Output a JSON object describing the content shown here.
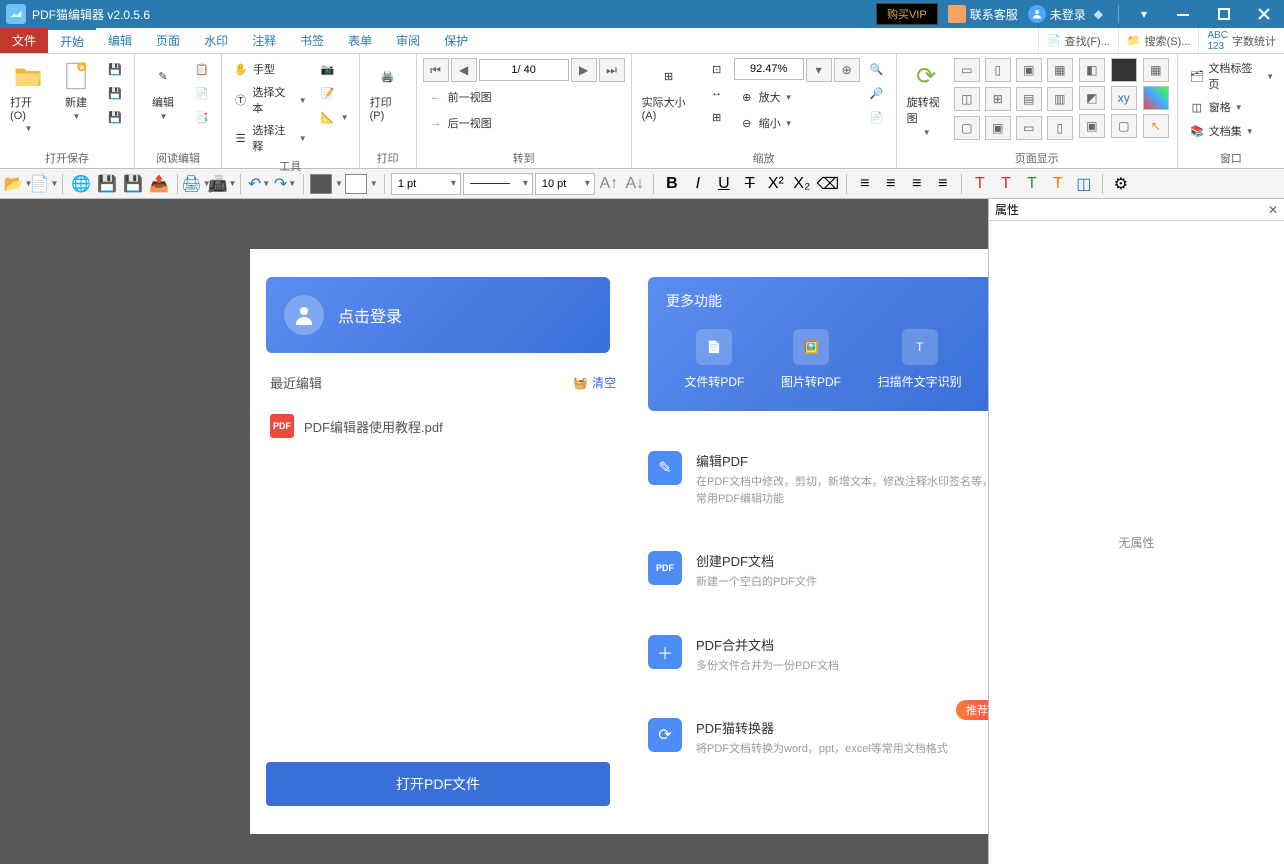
{
  "titlebar": {
    "app_name": "PDF猫编辑器 v2.0.5.6",
    "vip": "购买VIP",
    "service": "联系客服",
    "login": "未登录"
  },
  "menutabs": {
    "file": "文件",
    "start": "开始",
    "edit": "编辑",
    "page": "页面",
    "watermark": "水印",
    "annotate": "注释",
    "bookmark": "书签",
    "form": "表单",
    "review": "审阅",
    "protect": "保护",
    "find": "查找(F)...",
    "search": "搜索(S)...",
    "wordcount": "字数统计"
  },
  "ribbon": {
    "open": "打开(O)",
    "new": "新建",
    "g_opensave": "打开保存",
    "edit": "编辑",
    "g_read_edit": "阅读编辑",
    "hand": "手型",
    "select_text": "选择文本",
    "select_annot": "选择注释",
    "g_tools": "工具",
    "print": "打印(P)",
    "g_print": "打印",
    "page_indicator": "1/ 40",
    "prev_view": "前一视图",
    "next_view": "后一视图",
    "g_goto": "转到",
    "actual_size": "实际大小(A)",
    "zoom_value": "92.47%",
    "zoom_in": "放大",
    "zoom_out": "缩小",
    "g_zoom": "缩放",
    "rotate_view": "旋转视图",
    "g_page_disp": "页面显示",
    "doc_tabs": "文档标签页",
    "panes": "窗格",
    "doc_set": "文档集",
    "g_window": "窗口"
  },
  "quickbar": {
    "pt": "1 pt",
    "fontsize": "10 pt"
  },
  "welcome": {
    "login_text": "点击登录",
    "recent_title": "最近编辑",
    "clear": "清空",
    "recent_file": "PDF编辑器使用教程.pdf",
    "open_btn": "打开PDF文件",
    "more_title": "更多功能",
    "more": {
      "file2pdf": "文件转PDF",
      "img2pdf": "图片转PDF",
      "ocr": "扫描件文字识别"
    },
    "tools": [
      {
        "title": "编辑PDF",
        "desc": "在PDF文档中修改，剪切，新增文本，修改注释水印签名等，常用PDF编辑功能"
      },
      {
        "title": "创建PDF文档",
        "desc": "新建一个空白的PDF文件"
      },
      {
        "title": "PDF合并文档",
        "desc": "多份文件合并为一份PDF文档"
      },
      {
        "title": "PDF猫转换器",
        "desc": "将PDF文档转换为word，ppt，excel等常用文档格式"
      }
    ],
    "recommend": "推荐"
  },
  "props": {
    "title": "属性",
    "empty": "无属性"
  }
}
